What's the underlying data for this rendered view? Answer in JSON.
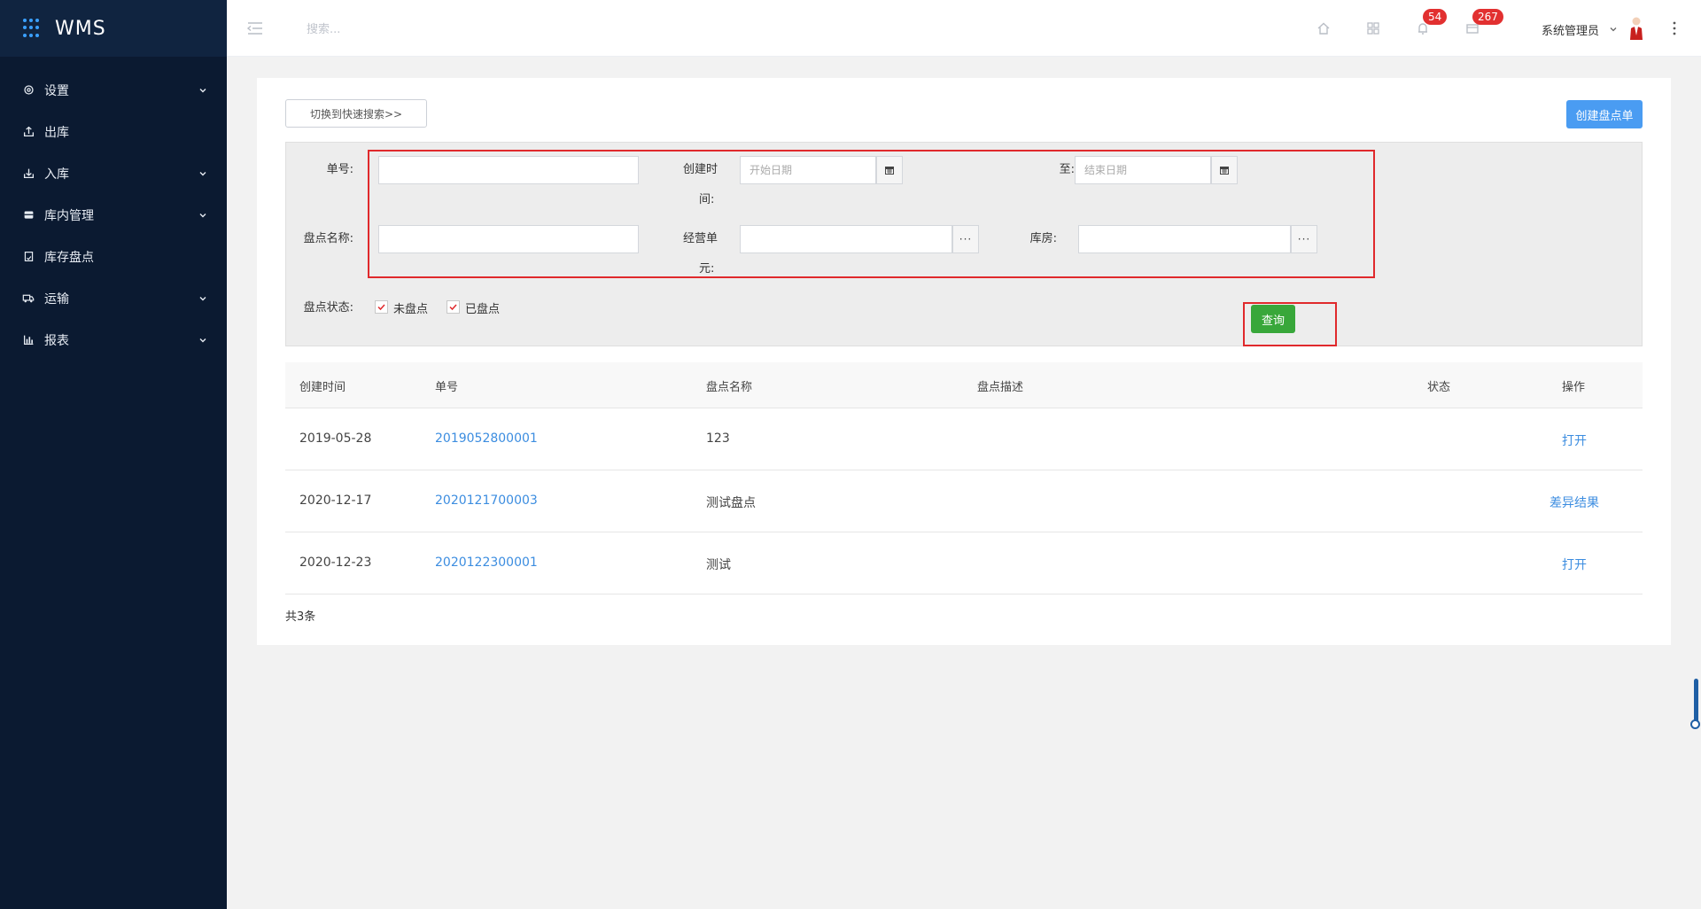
{
  "brand": {
    "title": "WMS"
  },
  "sidebar": {
    "items": [
      {
        "label": "设置",
        "icon": "gear-icon",
        "expandable": true
      },
      {
        "label": "出库",
        "icon": "outbound-icon",
        "expandable": false
      },
      {
        "label": "入库",
        "icon": "inbound-icon",
        "expandable": true
      },
      {
        "label": "库内管理",
        "icon": "warehouse-icon",
        "expandable": true
      },
      {
        "label": "库存盘点",
        "icon": "inventory-check-icon",
        "expandable": false
      },
      {
        "label": "运输",
        "icon": "truck-icon",
        "expandable": true
      },
      {
        "label": "报表",
        "icon": "bar-chart-icon",
        "expandable": true
      }
    ]
  },
  "topbar": {
    "search_placeholder": "搜索...",
    "notifications_count": "54",
    "messages_count": "267",
    "user_name": "系统管理员"
  },
  "main": {
    "switch_search_label": "切换到快速搜索>>",
    "create_button_label": "创建盘点单",
    "form": {
      "order_no_label": "单号:",
      "created_time_label_1": "创建时",
      "created_time_label_2": "间:",
      "start_date_placeholder": "开始日期",
      "to_label": "至:",
      "end_date_placeholder": "结束日期",
      "check_name_label": "盘点名称:",
      "business_unit_label_1": "经营单",
      "business_unit_label_2": "元:",
      "warehouse_label": "库房:",
      "status_label": "盘点状态:",
      "status_unchecked_label": "未盘点",
      "status_checked_label": "已盘点",
      "query_button_label": "查询",
      "ellipsis": "···"
    },
    "table": {
      "columns": [
        "创建时间",
        "单号",
        "盘点名称",
        "盘点描述",
        "状态",
        "操作"
      ],
      "rows": [
        {
          "created": "2019-05-28",
          "order_no": "2019052800001",
          "name": "123",
          "desc": "",
          "status": "",
          "action": "打开"
        },
        {
          "created": "2020-12-17",
          "order_no": "2020121700003",
          "name": "测试盘点",
          "desc": "",
          "status": "",
          "action": "差异结果"
        },
        {
          "created": "2020-12-23",
          "order_no": "2020122300001",
          "name": "测试",
          "desc": "",
          "status": "",
          "action": "打开"
        }
      ]
    },
    "total_text": "共3条"
  },
  "colors": {
    "sidebar_bg": "#0b1a31",
    "primary": "#4a9cf2",
    "query_green": "#38a73a",
    "link": "#3c8de0",
    "highlight_red": "#e0292c",
    "badge_red": "#e23030"
  }
}
